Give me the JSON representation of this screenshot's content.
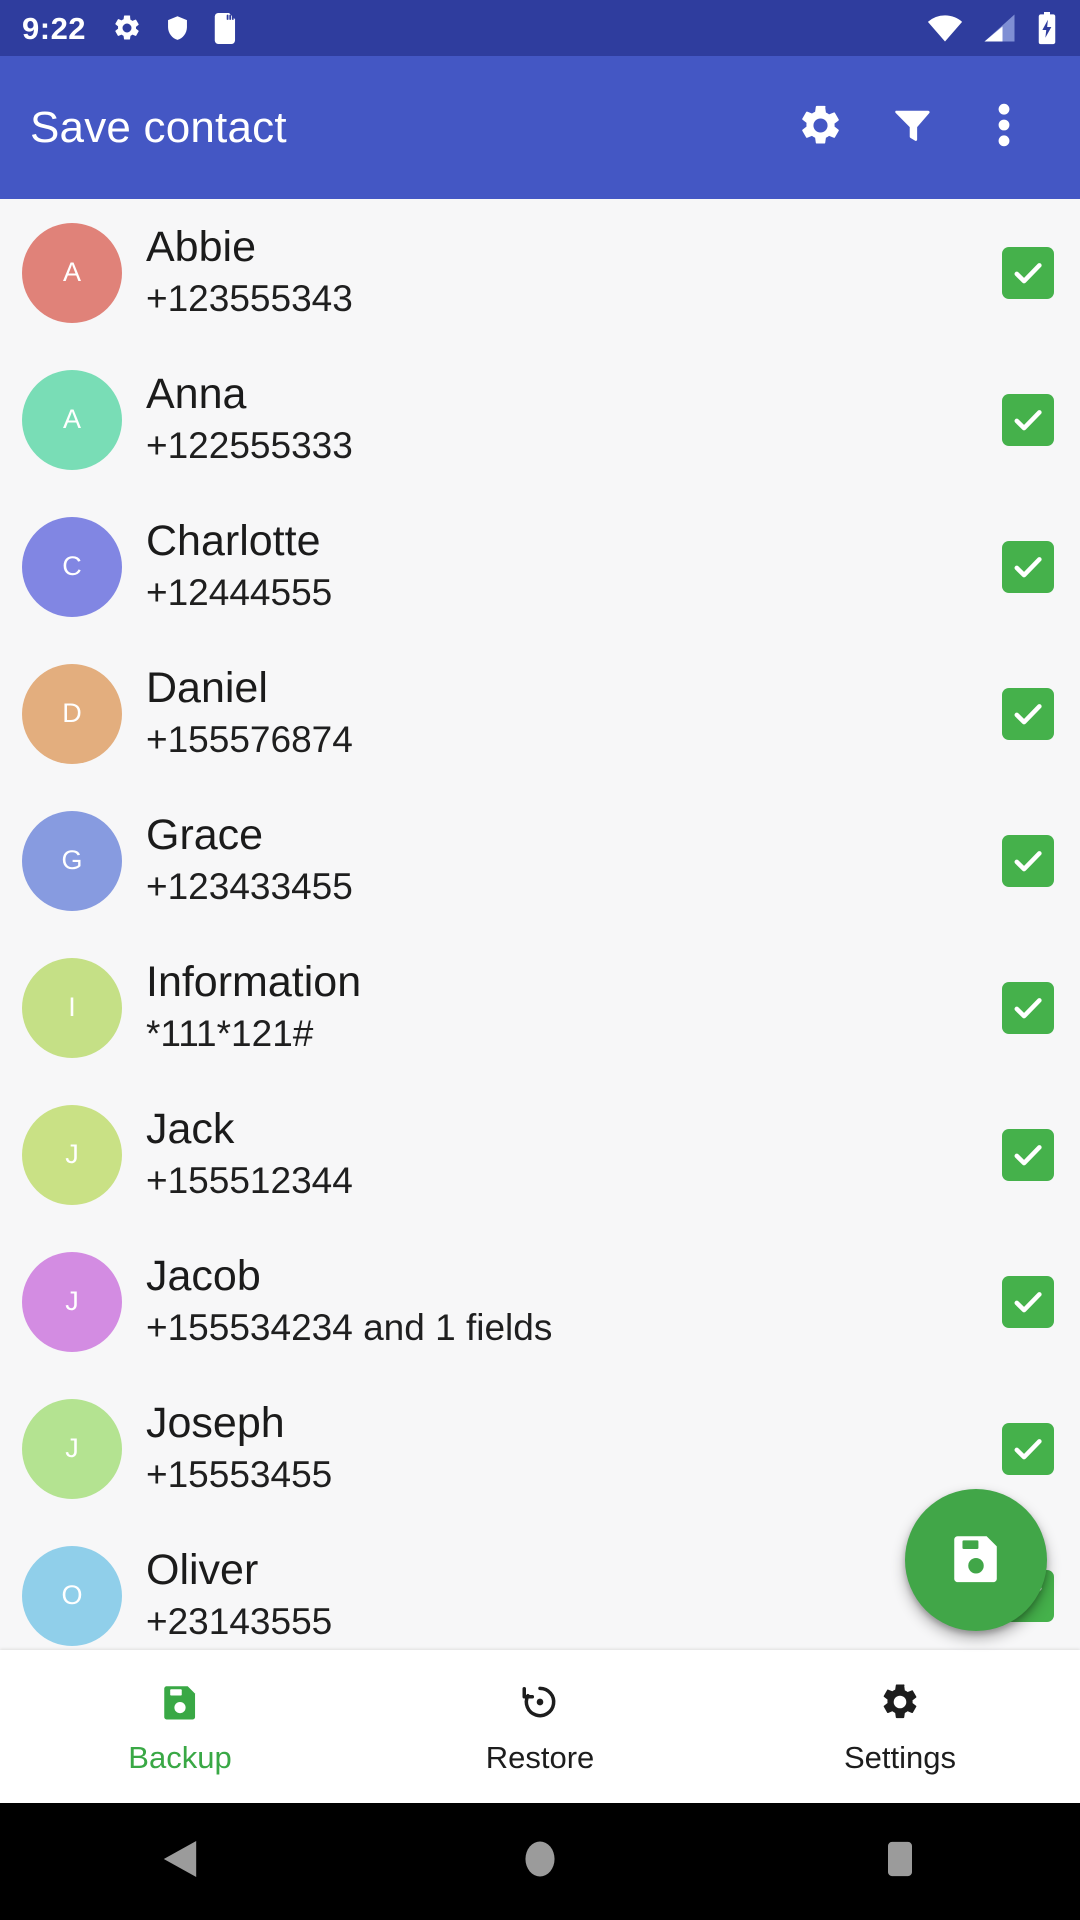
{
  "statusbar": {
    "time": "9:22",
    "left_icons": [
      "gear-icon",
      "shield-icon",
      "sd-card-icon"
    ],
    "right_icons": [
      "wifi-icon",
      "signal-icon",
      "battery-charging-icon"
    ],
    "background": "#2F3D9E"
  },
  "toolbar": {
    "title": "Save contact",
    "background": "#4457C4",
    "actions": [
      {
        "name": "settings-gear",
        "icon": "gear-icon"
      },
      {
        "name": "filter",
        "icon": "filter-icon"
      },
      {
        "name": "overflow-menu",
        "icon": "more-vert-icon"
      }
    ]
  },
  "contacts": [
    {
      "initial": "A",
      "name": "Abbie",
      "phone": "+123555343",
      "color": "#E08279",
      "checked": true
    },
    {
      "initial": "A",
      "name": "Anna",
      "phone": "+122555333",
      "color": "#79DDB6",
      "checked": true
    },
    {
      "initial": "C",
      "name": "Charlotte",
      "phone": "+12444555",
      "color": "#8186E3",
      "checked": true
    },
    {
      "initial": "D",
      "name": "Daniel",
      "phone": "+155576874",
      "color": "#E3AE7E",
      "checked": true
    },
    {
      "initial": "G",
      "name": "Grace",
      "phone": "+123433455",
      "color": "#879BE0",
      "checked": true
    },
    {
      "initial": "I",
      "name": "Information",
      "phone": "*111*121#",
      "color": "#C5E086",
      "checked": true
    },
    {
      "initial": "J",
      "name": "Jack",
      "phone": "+155512344",
      "color": "#C9E185",
      "checked": true
    },
    {
      "initial": "J",
      "name": "Jacob",
      "phone": "+155534234 and 1 fields",
      "color": "#D38CE2",
      "checked": true
    },
    {
      "initial": "J",
      "name": "Joseph",
      "phone": "+15553455",
      "color": "#B4E391",
      "checked": true
    },
    {
      "initial": "O",
      "name": "Oliver",
      "phone": "+23143555",
      "color": "#90CFEA",
      "checked": true
    }
  ],
  "fab": {
    "name": "save-fab",
    "icon": "save-floppy-icon",
    "color": "#41A648"
  },
  "bottom_nav": {
    "active_color": "#39A845",
    "items": [
      {
        "label": "Backup",
        "icon": "save-floppy-icon",
        "active": true
      },
      {
        "label": "Restore",
        "icon": "restore-icon",
        "active": false
      },
      {
        "label": "Settings",
        "icon": "gear-icon",
        "active": false
      }
    ]
  },
  "android_nav": {
    "items": [
      {
        "name": "back-button",
        "icon": "triangle-back-icon"
      },
      {
        "name": "home-button",
        "icon": "circle-home-icon"
      },
      {
        "name": "recents-button",
        "icon": "square-recents-icon"
      }
    ]
  }
}
